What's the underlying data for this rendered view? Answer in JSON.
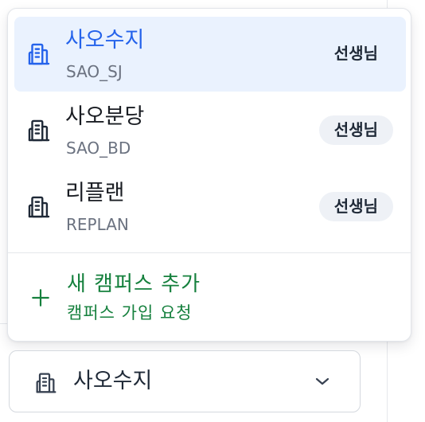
{
  "campus_menu": {
    "items": [
      {
        "name": "사오수지",
        "code": "SAO_SJ",
        "role": "선생님",
        "icon": "building-icon"
      },
      {
        "name": "사오분당",
        "code": "SAO_BD",
        "role": "선생님",
        "icon": "building-icon"
      },
      {
        "name": "리플랜",
        "code": "REPLAN",
        "role": "선생님",
        "icon": "building-icon"
      }
    ],
    "selected_index": 0,
    "add_campus": {
      "title": "새 캠퍼스 추가",
      "subtitle": "캠퍼스 가입 요청",
      "icon": "plus-icon"
    }
  },
  "campus_selector": {
    "value": "사오수지",
    "icon": "building-icon",
    "chevron": "chevron-down-icon"
  },
  "colors": {
    "accent": "#2563eb",
    "selected_bg": "#eaf2fe",
    "add_green": "#15803d",
    "badge_bg": "#eef1f6"
  }
}
